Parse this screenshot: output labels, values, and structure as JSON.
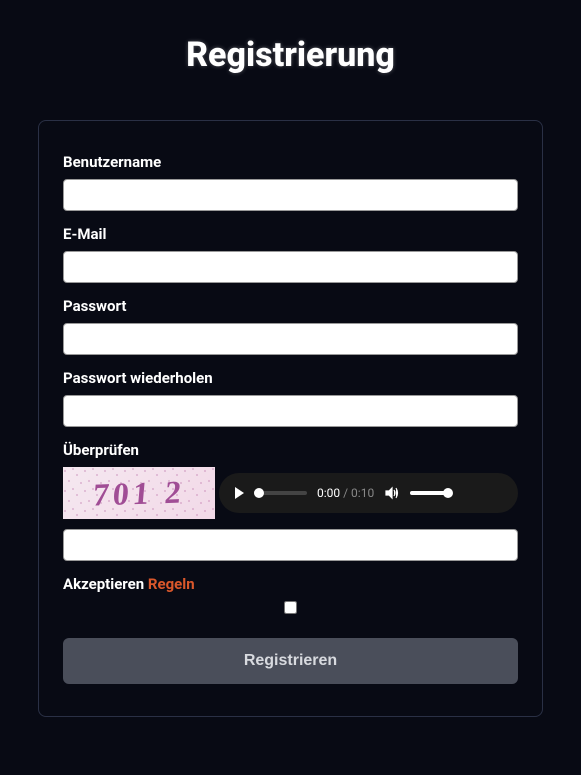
{
  "title": "Registrierung",
  "fields": {
    "username": {
      "label": "Benutzername",
      "value": ""
    },
    "email": {
      "label": "E-Mail",
      "value": ""
    },
    "password": {
      "label": "Passwort",
      "value": ""
    },
    "password2": {
      "label": "Passwort wiederholen",
      "value": ""
    },
    "verify": {
      "label": "Überprüfen",
      "captcha_text": "701 2",
      "value": ""
    }
  },
  "audio": {
    "current": "0:00",
    "separator": " / ",
    "total": "0:10"
  },
  "accept": {
    "label": "Akzeptieren ",
    "link": "Regeln"
  },
  "submit": "Registrieren"
}
